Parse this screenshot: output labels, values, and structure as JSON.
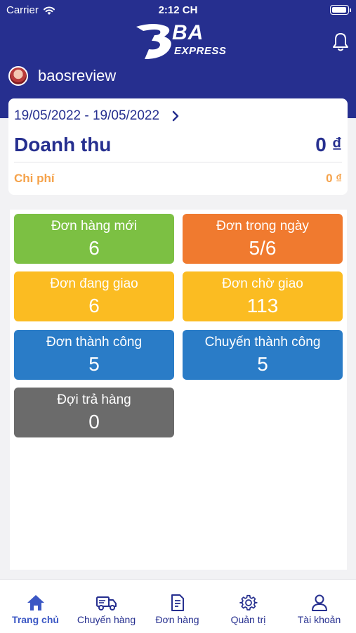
{
  "status_bar": {
    "carrier": "Carrier",
    "time": "2:12 CH"
  },
  "header": {
    "logo_main": "BA",
    "logo_sub": "EXPRESS",
    "username": "baosreview"
  },
  "revenue": {
    "date_range": "19/05/2022 - 19/05/2022",
    "doanh_thu_label": "Doanh thu",
    "doanh_thu_value": "0 ₫",
    "chi_phi_label": "Chi phí",
    "chi_phi_value": "0 ₫"
  },
  "stats": [
    {
      "label": "Đơn hàng mới",
      "value": "6",
      "color": "#7cc043"
    },
    {
      "label": "Đơn trong ngày",
      "value": "5/6",
      "color": "#f07a2f"
    },
    {
      "label": "Đơn đang giao",
      "value": "6",
      "color": "#fbbc22"
    },
    {
      "label": "Đơn chờ giao",
      "value": "113",
      "color": "#fbbc22"
    },
    {
      "label": "Đơn thành công",
      "value": "5",
      "color": "#2a7cc7"
    },
    {
      "label": "Chuyến thành công",
      "value": "5",
      "color": "#2a7cc7"
    },
    {
      "label": "Đợi trả hàng",
      "value": "0",
      "color": "#6b6b6b"
    }
  ],
  "tabs": [
    {
      "label": "Trang chủ",
      "icon": "home-icon"
    },
    {
      "label": "Chuyến hàng",
      "icon": "truck-icon"
    },
    {
      "label": "Đơn hàng",
      "icon": "document-icon"
    },
    {
      "label": "Quản trị",
      "icon": "gear-icon"
    },
    {
      "label": "Tài khoản",
      "icon": "user-icon"
    }
  ],
  "colors": {
    "brand": "#262f8f",
    "active_tab": "#3b57c4",
    "cost": "#f5a24a"
  },
  "battery_level": 1.0
}
